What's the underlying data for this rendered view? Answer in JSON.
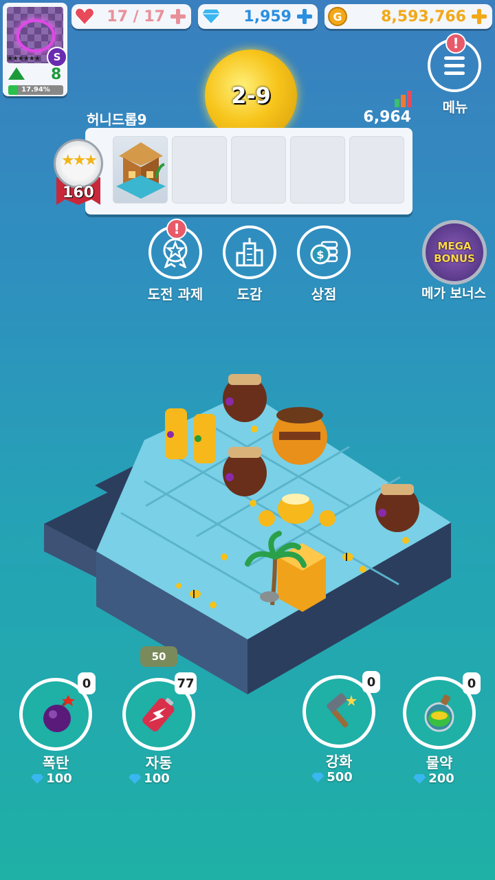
{
  "player": {
    "card_rank": "S",
    "card_stars": "★★★★★★",
    "level": "8",
    "level_progress_text": "17.94%",
    "level_progress": 0.1794
  },
  "resources": {
    "hearts": "17 / 17",
    "gems": "1,959",
    "gold": "8,593,766"
  },
  "stage": {
    "orb_label": "2-9",
    "name": "허니드롭9",
    "score": "6,964",
    "medal_number": "160",
    "medal_stars": "★★★",
    "slots_filled": 1,
    "slots_total": 5
  },
  "menu": {
    "label": "메뉴",
    "alert": "!"
  },
  "nav": [
    {
      "label": "도전 과제",
      "icon": "medal-star-icon",
      "alert": "!"
    },
    {
      "label": "도감",
      "icon": "buildings-icon"
    },
    {
      "label": "상점",
      "icon": "coins-icon"
    }
  ],
  "mega_bonus": {
    "badge_line1": "MEGA",
    "badge_line2": "BONUS",
    "label": "메가 보너스"
  },
  "tools": [
    {
      "label": "폭탄",
      "icon": "bomb-icon",
      "count": "0",
      "cost": "100"
    },
    {
      "label": "자동",
      "icon": "battery-icon",
      "count": "77",
      "cost": "100",
      "tag": "50"
    },
    {
      "label": "강화",
      "icon": "hammer-icon",
      "count": "0",
      "cost": "500"
    },
    {
      "label": "물약",
      "icon": "potion-icon",
      "count": "0",
      "cost": "200"
    }
  ],
  "colors": {
    "heart": "#e84a5a",
    "gem": "#2a8fe0",
    "gold": "#f2a818",
    "panel": "#f3f6fa"
  }
}
